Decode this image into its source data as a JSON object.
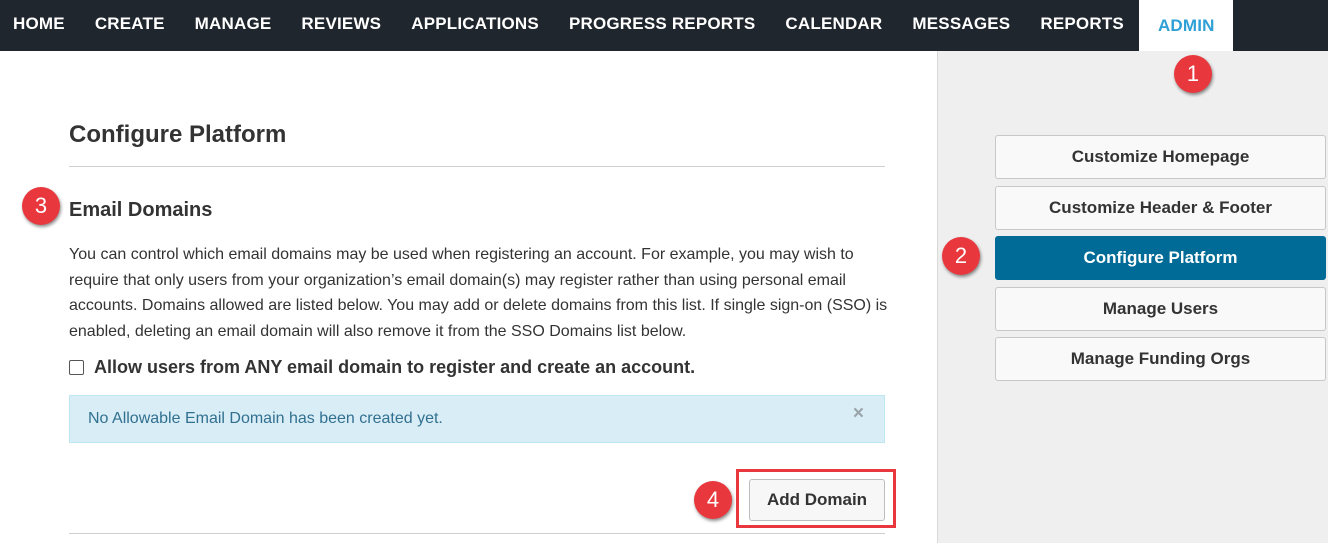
{
  "nav": {
    "items": [
      {
        "label": "HOME"
      },
      {
        "label": "CREATE"
      },
      {
        "label": "MANAGE"
      },
      {
        "label": "REVIEWS"
      },
      {
        "label": "APPLICATIONS"
      },
      {
        "label": "PROGRESS REPORTS"
      },
      {
        "label": "CALENDAR"
      },
      {
        "label": "MESSAGES"
      },
      {
        "label": "REPORTS"
      },
      {
        "label": "ADMIN",
        "active": true
      }
    ]
  },
  "main": {
    "page_title": "Configure Platform",
    "section_title": "Email Domains",
    "description": "You can control which email domains may be used when registering an account. For example, you may wish to require that only users from your organization’s email domain(s) may register rather than using personal email accounts. Domains allowed are listed below. You may add or delete domains from this list. If single sign-on (SSO) is enabled, deleting an email domain will also remove it from the SSO Domains list below.",
    "allow_any_label": "Allow users from ANY email domain to register and create an account.",
    "allow_any_checked": false,
    "alert_text": "No Allowable Email Domain has been created yet.",
    "alert_close": "×",
    "add_domain_label": "Add Domain"
  },
  "sidebar": {
    "items": [
      {
        "label": "Customize Homepage"
      },
      {
        "label": "Customize Header & Footer"
      },
      {
        "label": "Configure Platform",
        "active": true
      },
      {
        "label": "Manage Users"
      },
      {
        "label": "Manage Funding Orgs"
      }
    ]
  },
  "markers": [
    "1",
    "2",
    "3",
    "4"
  ],
  "colors": {
    "nav_bg": "#20262d",
    "nav_active_text": "#2ea0d6",
    "sidebar_active": "#006b96",
    "marker": "#e8383d",
    "alert_bg": "#d9edf7",
    "alert_text": "#31708f"
  }
}
